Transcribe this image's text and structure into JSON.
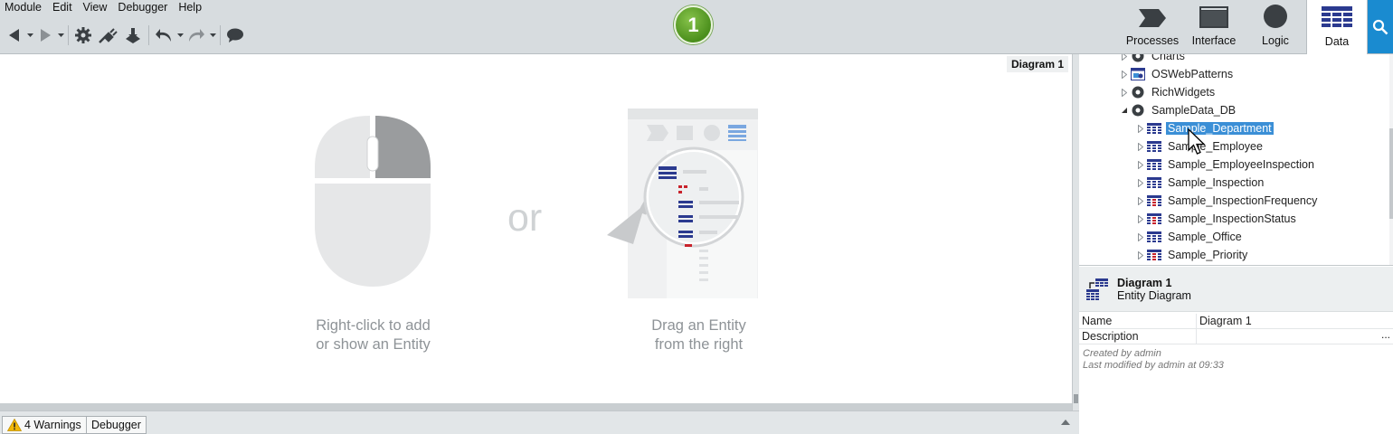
{
  "menu": [
    "Module",
    "Edit",
    "View",
    "Debugger",
    "Help"
  ],
  "version_badge": "1",
  "layer_tabs": [
    {
      "label": "Processes"
    },
    {
      "label": "Interface"
    },
    {
      "label": "Logic"
    },
    {
      "label": "Data",
      "active": true
    }
  ],
  "canvas": {
    "diagram_label": "Diagram 1",
    "hint_left_1": "Right-click to add",
    "hint_left_2": "or show an Entity",
    "or": "or",
    "hint_right_1": "Drag an Entity",
    "hint_right_2": "from the right"
  },
  "bottom_tabs": {
    "warnings": "4 Warnings",
    "debugger": "Debugger"
  },
  "tree": {
    "items": [
      {
        "label": "Charts",
        "indent": 1,
        "expanded": false,
        "icon": "module-icon"
      },
      {
        "label": "OSWebPatterns",
        "indent": 1,
        "expanded": false,
        "icon": "web-module-icon"
      },
      {
        "label": "RichWidgets",
        "indent": 1,
        "expanded": false,
        "icon": "module-icon"
      },
      {
        "label": "SampleData_DB",
        "indent": 1,
        "expanded": true,
        "icon": "module-icon"
      },
      {
        "label": "Sample_Department",
        "indent": 2,
        "expanded": false,
        "icon": "entity-icon",
        "selected": true
      },
      {
        "label": "Sample_Employee",
        "indent": 2,
        "expanded": false,
        "icon": "entity-icon"
      },
      {
        "label": "Sample_EmployeeInspection",
        "indent": 2,
        "expanded": false,
        "icon": "entity-icon"
      },
      {
        "label": "Sample_Inspection",
        "indent": 2,
        "expanded": false,
        "icon": "entity-icon"
      },
      {
        "label": "Sample_InspectionFrequency",
        "indent": 2,
        "expanded": false,
        "icon": "static-entity-icon"
      },
      {
        "label": "Sample_InspectionStatus",
        "indent": 2,
        "expanded": false,
        "icon": "static-entity-icon"
      },
      {
        "label": "Sample_Office",
        "indent": 2,
        "expanded": false,
        "icon": "entity-icon"
      },
      {
        "label": "Sample_Priority",
        "indent": 2,
        "expanded": false,
        "icon": "static-entity-icon"
      }
    ]
  },
  "properties": {
    "title": "Diagram 1",
    "subtitle": "Entity Diagram",
    "rows": [
      {
        "key": "Name",
        "value": "Diagram 1"
      },
      {
        "key": "Description",
        "value": "",
        "more": "..."
      }
    ],
    "created_by": "Created by admin",
    "modified_by": "Last modified by admin at 09:33"
  },
  "colors": {
    "accent": "#1a8bd0",
    "selection": "#3b8fd6",
    "chrome": "#d7dcdf",
    "entity_blue": "#2b3a8f",
    "static_entity_red": "#c8232c"
  }
}
